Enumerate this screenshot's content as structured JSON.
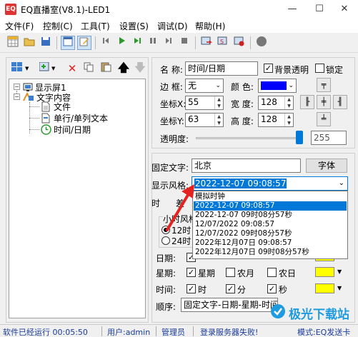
{
  "window": {
    "title": "EQ直播室(V8.1)-LED1",
    "app_icon_text": "EQ",
    "minimize_glyph": "—",
    "maximize_glyph": "☐",
    "close_glyph": "✕"
  },
  "menu": [
    "文件(F)",
    "控制(C)",
    "工具(T)",
    "设置(S)",
    "调试(D)",
    "帮助(H)"
  ],
  "toolbar": {
    "icons": [
      "grid-icon",
      "open-folder-icon",
      "save-icon",
      "window-icon",
      "edit-icon",
      "first-icon",
      "play-icon",
      "step-icon",
      "pause-icon",
      "next-icon",
      "stop-icon",
      "export-icon",
      "send-icon",
      "settings-icon",
      "record-icon"
    ]
  },
  "tree": {
    "root": "显示屏1",
    "group": "文字内容",
    "children": [
      "文件",
      "单行/单列文本",
      "时间/日期"
    ]
  },
  "props": {
    "name_label": "名 称:",
    "name_value": "时间/日期",
    "bg_transparent_label": "背景透明",
    "bg_transparent_checked": true,
    "lock_label": "锁定",
    "lock_checked": false,
    "border_label": "边 框:",
    "border_value": "无",
    "color_label": "颜 色:",
    "color_value": "#0000ff",
    "x_label": "坐标X:",
    "x_value": "55",
    "width_label": "宽 度:",
    "width_value": "128",
    "y_label": "坐标Y:",
    "y_value": "63",
    "height_label": "高 度:",
    "height_value": "128",
    "transparency_label": "透明度:",
    "transparency_value": "255",
    "transparency_fraction": 1.0
  },
  "text_settings": {
    "fixed_text_label": "固定文字:",
    "fixed_text_value": "北京",
    "font_button": "字体",
    "style_label": "显示风格:",
    "style_value": "2022-12-07 09:08:57",
    "time_label": "时",
    "diff_label": "差",
    "hour_label": "小时风格",
    "hour12": "12时",
    "hour24": "24时",
    "date_label": "日期:",
    "week_label": "星期:",
    "week_opt1": "星期",
    "week_opt2": "农月",
    "week_opt3": "农日",
    "time_row_label": "时间:",
    "time_opt1": "时",
    "time_opt2": "分",
    "time_opt3": "秒",
    "order_label": "顺序:",
    "order_value": "固定文字-日期-星期-时间",
    "swatch_color": "#ffff00"
  },
  "dropdown_options": [
    "模拟时钟",
    "2022-12-07 09:08:57",
    "2022-12-07 09时08分57秒",
    "12/07/2022 09:08:57",
    "12/07/2022 09时08分57秒",
    "2022年12月07日 09:08:57",
    "2022年12月07日 09时08分57秒"
  ],
  "dropdown_selected_index": 1,
  "status": {
    "running": "软件已经运行 00:05:50",
    "user": "用户:admin",
    "role": "管理员",
    "server": "登录服务器失败!",
    "mode": "模式:EQ发送卡"
  },
  "watermark": "极光下载站"
}
